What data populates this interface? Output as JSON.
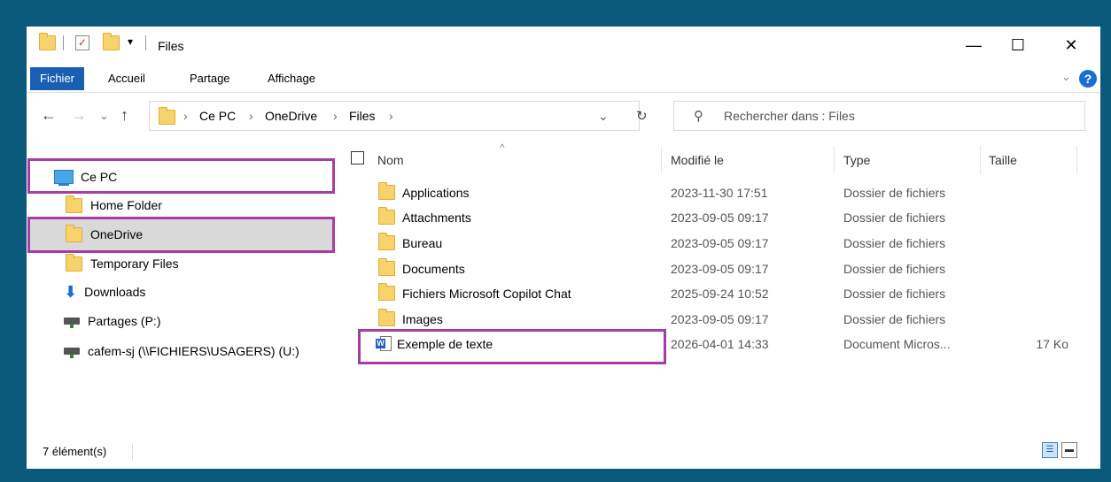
{
  "window": {
    "title": "Files",
    "qa_pin": "▾",
    "minimize": "—",
    "maximize": "☐",
    "close": "✕"
  },
  "ribbon": {
    "tabs": [
      "Fichier",
      "Accueil",
      "Partage",
      "Affichage"
    ],
    "expand": "⌄",
    "help": "?"
  },
  "nav": {
    "back": "←",
    "forward": "→",
    "recent": "⌄",
    "up": "↑",
    "breadcrumb": [
      "Ce PC",
      "OneDrive",
      "Files"
    ],
    "crumb_sep": "›",
    "dropdown": "⌄",
    "refresh": "↻"
  },
  "search": {
    "icon": "⚲",
    "placeholder": "Rechercher dans : Files"
  },
  "navpane": {
    "items": [
      {
        "label": "Ce PC",
        "icon": "computer-icon"
      },
      {
        "label": "Home Folder",
        "icon": "folder-icon"
      },
      {
        "label": "OneDrive",
        "icon": "folder-icon"
      },
      {
        "label": "Temporary Files",
        "icon": "folder-icon"
      },
      {
        "label": "Downloads",
        "icon": "download-icon"
      },
      {
        "label": "Partages (P:)",
        "icon": "network-drive-icon"
      },
      {
        "label": "cafem-sj (\\\\FICHIERS\\USAGERS) (U:)",
        "icon": "network-drive-icon"
      }
    ],
    "selected": "OneDrive"
  },
  "content": {
    "sort_indicator": "^",
    "columns": [
      "Nom",
      "Modifié le",
      "Type",
      "Taille"
    ],
    "rows": [
      {
        "name": "Applications",
        "modified": "2023-11-30 17:51",
        "type": "Dossier de fichiers",
        "size": "",
        "icon": "folder-icon"
      },
      {
        "name": "Attachments",
        "modified": "2023-09-05 09:17",
        "type": "Dossier de fichiers",
        "size": "",
        "icon": "folder-icon"
      },
      {
        "name": "Bureau",
        "modified": "2023-09-05 09:17",
        "type": "Dossier de fichiers",
        "size": "",
        "icon": "folder-icon"
      },
      {
        "name": "Documents",
        "modified": "2023-09-05 09:17",
        "type": "Dossier de fichiers",
        "size": "",
        "icon": "folder-icon"
      },
      {
        "name": "Fichiers Microsoft Copilot Chat",
        "modified": "2025-09-24 10:52",
        "type": "Dossier de fichiers",
        "size": "",
        "icon": "folder-icon"
      },
      {
        "name": "Images",
        "modified": "2023-09-05 09:17",
        "type": "Dossier de fichiers",
        "size": "",
        "icon": "folder-icon"
      },
      {
        "name": "Exemple de texte",
        "modified": "2026-04-01 14:33",
        "type": "Document Micros...",
        "size": "17 Ko",
        "icon": "word-document-icon"
      }
    ]
  },
  "status": {
    "count": "7 élément(s)"
  },
  "colors": {
    "background": "#0b5a7c",
    "accent": "#1a5fb4",
    "highlight": "#a63da6",
    "folder": "#f8d26b"
  }
}
